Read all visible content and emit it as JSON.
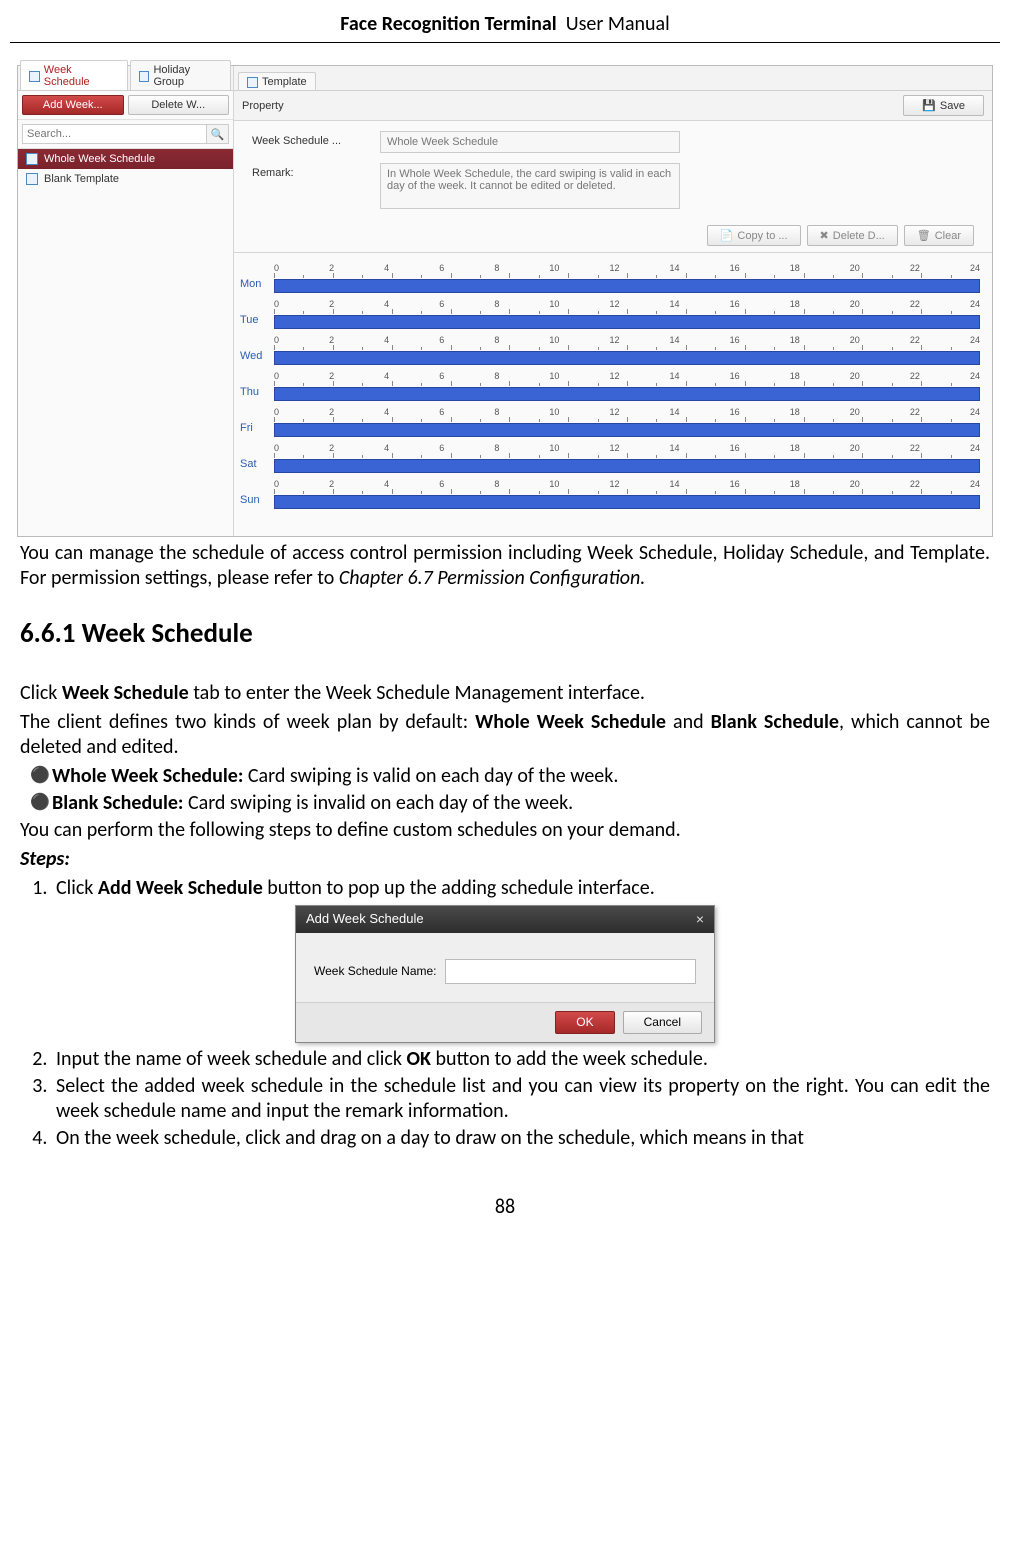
{
  "header": {
    "bold": "Face Recognition Terminal",
    "rest": "User Manual"
  },
  "shot1": {
    "tabs": [
      "Week Schedule",
      "Holiday Group",
      "Template"
    ],
    "btn_add": "Add Week...",
    "btn_del": "Delete W...",
    "search_placeholder": "Search...",
    "items": [
      "Whole Week Schedule",
      "Blank Template"
    ],
    "property_title": "Property",
    "save": "Save",
    "form_name_label": "Week Schedule ...",
    "form_name_value": "Whole Week Schedule",
    "form_remark_label": "Remark:",
    "form_remark_value": "In Whole Week Schedule, the card swiping is valid in each day of the week. It cannot be edited or deleted.",
    "act_copy": "Copy to ...",
    "act_delete": "Delete D...",
    "act_clear": "Clear",
    "days": [
      "Mon",
      "Tue",
      "Wed",
      "Thu",
      "Fri",
      "Sat",
      "Sun"
    ],
    "hours": [
      "0",
      "2",
      "4",
      "6",
      "8",
      "10",
      "12",
      "14",
      "16",
      "18",
      "20",
      "22",
      "24"
    ]
  },
  "para1_a": "You can manage the schedule of access control permission including Week Schedule, Holiday Schedule, and Template. For permission settings, please refer to ",
  "para1_b": "Chapter 6.7 Permission Configuration.",
  "h2": "6.6.1 Week Schedule",
  "p2_a": "Click ",
  "p2_b": "Week Schedule",
  "p2_c": " tab to enter the Week Schedule Management interface.",
  "p3_a": "The client defines two kinds of week plan by default: ",
  "p3_b": "Whole Week Schedule",
  "p3_c": " and ",
  "p3_d": "Blank Schedule",
  "p3_e": ", which cannot be deleted and edited.",
  "bul1_b": "Whole Week Schedule:",
  "bul1_t": " Card swiping is valid on each day of the week.",
  "bul2_b": "Blank Schedule:",
  "bul2_t": " Card swiping is invalid on each day of the week.",
  "p4": "You can perform the following steps to define custom schedules on your demand.",
  "steps_label": "Steps:",
  "step1_a": "Click ",
  "step1_b": "Add Week Schedule",
  "step1_c": " button to pop up the adding schedule interface.",
  "dialog": {
    "title": "Add Week Schedule",
    "label": "Week Schedule Name:",
    "ok": "OK",
    "cancel": "Cancel"
  },
  "step2_a": "Input the name of week schedule and click ",
  "step2_b": "OK",
  "step2_c": " button to add the week schedule.",
  "step3": "Select the added week schedule in the schedule list and you can view its property on the right. You can edit the week schedule name and input the remark information.",
  "step4": "On the week schedule, click and drag on a day to draw on the schedule, which means in that",
  "pagenum": "88"
}
